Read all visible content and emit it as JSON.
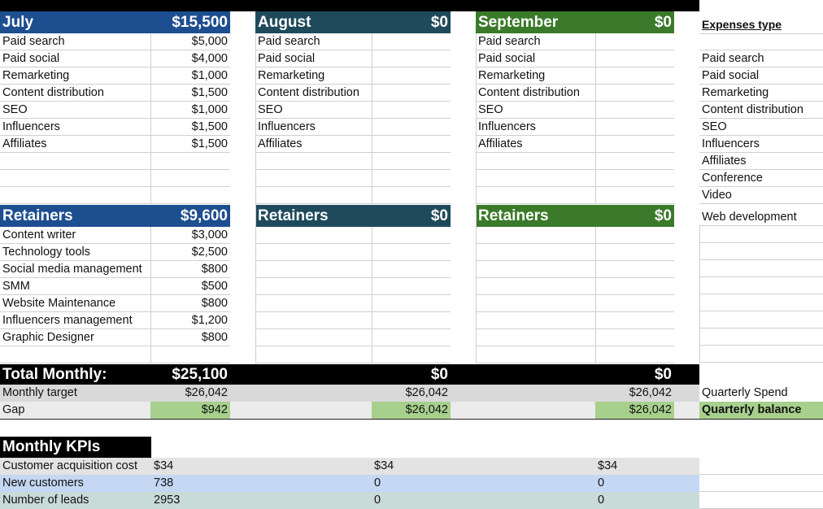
{
  "months": [
    {
      "name": "July",
      "expenses_total": "$15,500",
      "retainers_title": "Retainers",
      "retainers_total": "$9,600",
      "color": "#1d4e8f",
      "expenses": [
        {
          "label": "Paid search",
          "value": "$5,000"
        },
        {
          "label": "Paid social",
          "value": "$4,000"
        },
        {
          "label": "Remarketing",
          "value": "$1,000"
        },
        {
          "label": "Content distribution",
          "value": "$1,500"
        },
        {
          "label": "SEO",
          "value": "$1,000"
        },
        {
          "label": "Influencers",
          "value": "$1,500"
        },
        {
          "label": "Affiliates",
          "value": "$1,500"
        }
      ],
      "retainers": [
        {
          "label": "Content writer",
          "value": "$3,000"
        },
        {
          "label": "Technology tools",
          "value": "$2,500"
        },
        {
          "label": "Social media management",
          "value": "$800"
        },
        {
          "label": "SMM",
          "value": "$500"
        },
        {
          "label": "Website Maintenance",
          "value": "$800"
        },
        {
          "label": "Influencers management",
          "value": "$1,200"
        },
        {
          "label": "Graphic Designer",
          "value": "$800"
        }
      ],
      "total_monthly_label": "Total Monthly:",
      "total_monthly": "$25,100",
      "target_label": "Monthly target",
      "target": "$26,042",
      "gap_label": "Gap",
      "gap": "$942"
    },
    {
      "name": "August",
      "expenses_total": "$0",
      "retainers_title": "Retainers",
      "retainers_total": "$0",
      "color": "#1e4a5c",
      "expenses": [
        {
          "label": "Paid search",
          "value": ""
        },
        {
          "label": "Paid social",
          "value": ""
        },
        {
          "label": "Remarketing",
          "value": ""
        },
        {
          "label": "Content distribution",
          "value": ""
        },
        {
          "label": "SEO",
          "value": ""
        },
        {
          "label": "Influencers",
          "value": ""
        },
        {
          "label": "Affiliates",
          "value": ""
        }
      ],
      "retainers": [],
      "total_monthly_label": "",
      "total_monthly": "$0",
      "target_label": "",
      "target": "$26,042",
      "gap_label": "",
      "gap": "$26,042"
    },
    {
      "name": "September",
      "expenses_total": "$0",
      "retainers_title": "Retainers",
      "retainers_total": "$0",
      "color": "#3a7a2a",
      "expenses": [
        {
          "label": "Paid search",
          "value": ""
        },
        {
          "label": "Paid social",
          "value": ""
        },
        {
          "label": "Remarketing",
          "value": ""
        },
        {
          "label": "Content distribution",
          "value": ""
        },
        {
          "label": "SEO",
          "value": ""
        },
        {
          "label": "Influencers",
          "value": ""
        },
        {
          "label": "Affiliates",
          "value": ""
        }
      ],
      "retainers": [],
      "total_monthly_label": "",
      "total_monthly": "$0",
      "target_label": "",
      "target": "$26,042",
      "gap_label": "",
      "gap": "$26,042"
    }
  ],
  "expenses_type": {
    "title": "Expenses type",
    "items": [
      "Paid search",
      "Paid social",
      "Remarketing",
      "Content distribution",
      "SEO",
      "Influencers",
      "Affiliates",
      "Conference",
      "Video",
      "Web development"
    ]
  },
  "quarterly": {
    "spend_label": "Quarterly Spend",
    "balance_label": "Quarterly balance"
  },
  "kpis": {
    "title": "Monthly KPIs",
    "rows": [
      {
        "label": "Customer acquisition cost",
        "values": [
          "$34",
          "$34",
          "$34"
        ]
      },
      {
        "label": "New customers",
        "values": [
          "738",
          "0",
          "0"
        ]
      },
      {
        "label": "Number of leads",
        "values": [
          "2953",
          "0",
          "0"
        ]
      }
    ]
  },
  "colors": {
    "total_bar": "#000000",
    "target_row": "#d9d9d9",
    "gap_row": "#ebebeb",
    "gap_highlight": "#a8d08d",
    "kpi_row1": "#e3e3e3",
    "kpi_row2": "#c4d7f3",
    "kpi_row3": "#c9dbd9"
  }
}
